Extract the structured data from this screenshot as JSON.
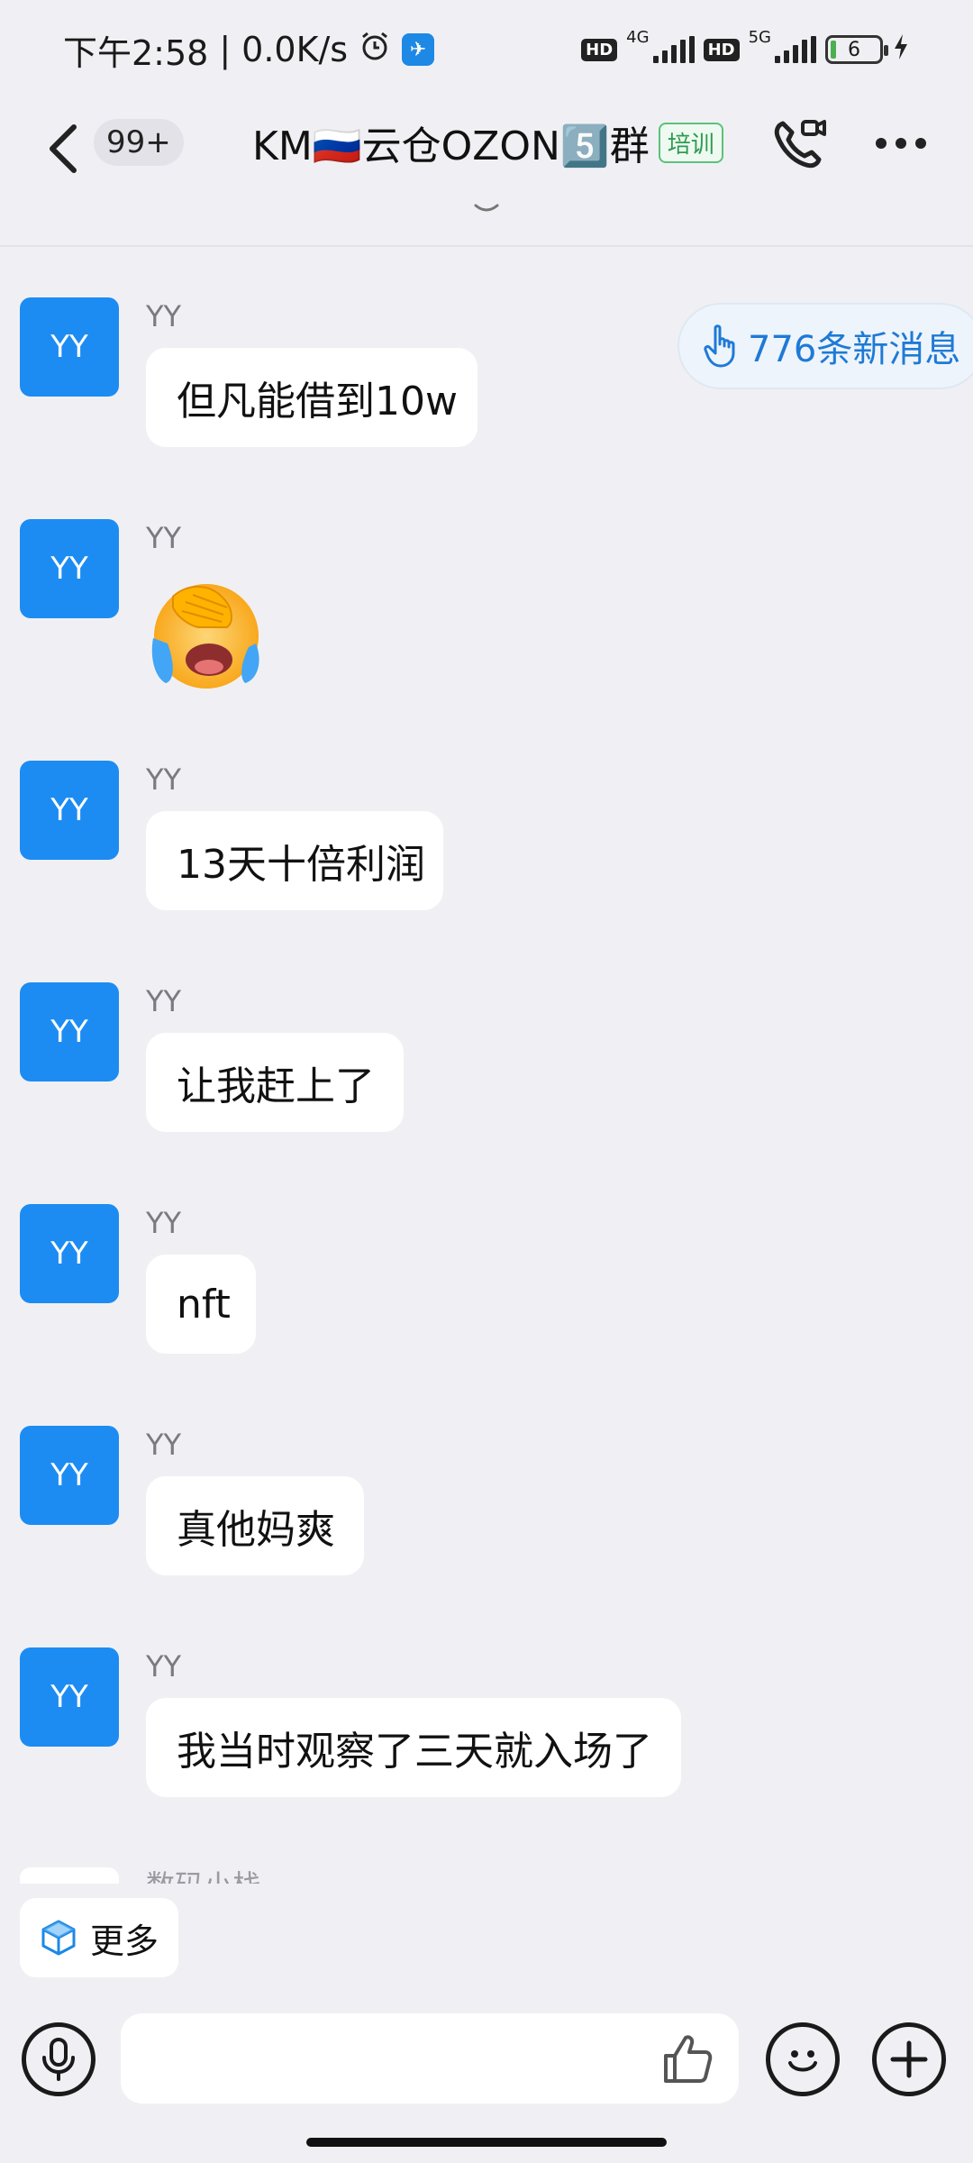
{
  "status_bar": {
    "time": "下午2:58",
    "network_speed": "0.0K/s",
    "separator": "|",
    "hd1": "HD",
    "net1": "4G",
    "hd2": "HD",
    "net2": "5G",
    "battery_level": "6",
    "icons": [
      "alarm-icon",
      "app-notification-icon",
      "signal-icon",
      "battery-icon",
      "charging-icon"
    ]
  },
  "header": {
    "unread_count": "99+",
    "title": "KM🇷🇺云仓OZON5️⃣群",
    "badge": "培训",
    "badge_color": "#2e9b4e"
  },
  "new_messages": {
    "label": "776条新消息",
    "color": "#1e7ad6"
  },
  "messages": [
    {
      "avatar": "YY",
      "sender": "YY",
      "text": "但凡能借到10w"
    },
    {
      "avatar": "YY",
      "sender": "YY",
      "sticker": "crying-laughing-face-emoji"
    },
    {
      "avatar": "YY",
      "sender": "YY",
      "text": "13天十倍利润"
    },
    {
      "avatar": "YY",
      "sender": "YY",
      "text": "让我赶上了"
    },
    {
      "avatar": "YY",
      "sender": "YY",
      "text": "nft"
    },
    {
      "avatar": "YY",
      "sender": "YY",
      "text": "真他妈爽"
    },
    {
      "avatar": "YY",
      "sender": "YY",
      "text": "我当时观察了三天就入场了"
    }
  ],
  "partial_message": {
    "sender": "数码小栈"
  },
  "more_chip": {
    "label": "更多"
  },
  "input": {
    "value": "",
    "placeholder": ""
  },
  "colors": {
    "avatar_bg": "#1c8cf3",
    "background": "#f0f0f4",
    "bubble": "#ffffff"
  }
}
